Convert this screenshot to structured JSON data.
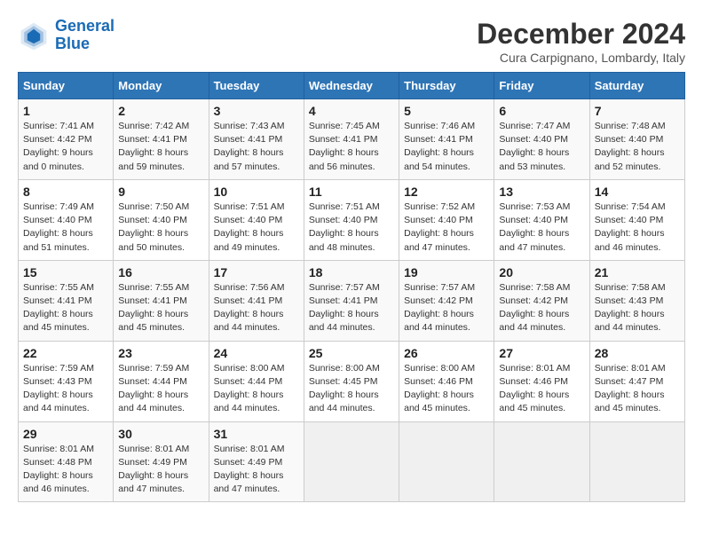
{
  "header": {
    "logo_line1": "General",
    "logo_line2": "Blue",
    "month_title": "December 2024",
    "subtitle": "Cura Carpignano, Lombardy, Italy"
  },
  "days_of_week": [
    "Sunday",
    "Monday",
    "Tuesday",
    "Wednesday",
    "Thursday",
    "Friday",
    "Saturday"
  ],
  "weeks": [
    [
      {
        "day": 1,
        "info": "Sunrise: 7:41 AM\nSunset: 4:42 PM\nDaylight: 9 hours\nand 0 minutes."
      },
      {
        "day": 2,
        "info": "Sunrise: 7:42 AM\nSunset: 4:41 PM\nDaylight: 8 hours\nand 59 minutes."
      },
      {
        "day": 3,
        "info": "Sunrise: 7:43 AM\nSunset: 4:41 PM\nDaylight: 8 hours\nand 57 minutes."
      },
      {
        "day": 4,
        "info": "Sunrise: 7:45 AM\nSunset: 4:41 PM\nDaylight: 8 hours\nand 56 minutes."
      },
      {
        "day": 5,
        "info": "Sunrise: 7:46 AM\nSunset: 4:41 PM\nDaylight: 8 hours\nand 54 minutes."
      },
      {
        "day": 6,
        "info": "Sunrise: 7:47 AM\nSunset: 4:40 PM\nDaylight: 8 hours\nand 53 minutes."
      },
      {
        "day": 7,
        "info": "Sunrise: 7:48 AM\nSunset: 4:40 PM\nDaylight: 8 hours\nand 52 minutes."
      }
    ],
    [
      {
        "day": 8,
        "info": "Sunrise: 7:49 AM\nSunset: 4:40 PM\nDaylight: 8 hours\nand 51 minutes."
      },
      {
        "day": 9,
        "info": "Sunrise: 7:50 AM\nSunset: 4:40 PM\nDaylight: 8 hours\nand 50 minutes."
      },
      {
        "day": 10,
        "info": "Sunrise: 7:51 AM\nSunset: 4:40 PM\nDaylight: 8 hours\nand 49 minutes."
      },
      {
        "day": 11,
        "info": "Sunrise: 7:51 AM\nSunset: 4:40 PM\nDaylight: 8 hours\nand 48 minutes."
      },
      {
        "day": 12,
        "info": "Sunrise: 7:52 AM\nSunset: 4:40 PM\nDaylight: 8 hours\nand 47 minutes."
      },
      {
        "day": 13,
        "info": "Sunrise: 7:53 AM\nSunset: 4:40 PM\nDaylight: 8 hours\nand 47 minutes."
      },
      {
        "day": 14,
        "info": "Sunrise: 7:54 AM\nSunset: 4:40 PM\nDaylight: 8 hours\nand 46 minutes."
      }
    ],
    [
      {
        "day": 15,
        "info": "Sunrise: 7:55 AM\nSunset: 4:41 PM\nDaylight: 8 hours\nand 45 minutes."
      },
      {
        "day": 16,
        "info": "Sunrise: 7:55 AM\nSunset: 4:41 PM\nDaylight: 8 hours\nand 45 minutes."
      },
      {
        "day": 17,
        "info": "Sunrise: 7:56 AM\nSunset: 4:41 PM\nDaylight: 8 hours\nand 44 minutes."
      },
      {
        "day": 18,
        "info": "Sunrise: 7:57 AM\nSunset: 4:41 PM\nDaylight: 8 hours\nand 44 minutes."
      },
      {
        "day": 19,
        "info": "Sunrise: 7:57 AM\nSunset: 4:42 PM\nDaylight: 8 hours\nand 44 minutes."
      },
      {
        "day": 20,
        "info": "Sunrise: 7:58 AM\nSunset: 4:42 PM\nDaylight: 8 hours\nand 44 minutes."
      },
      {
        "day": 21,
        "info": "Sunrise: 7:58 AM\nSunset: 4:43 PM\nDaylight: 8 hours\nand 44 minutes."
      }
    ],
    [
      {
        "day": 22,
        "info": "Sunrise: 7:59 AM\nSunset: 4:43 PM\nDaylight: 8 hours\nand 44 minutes."
      },
      {
        "day": 23,
        "info": "Sunrise: 7:59 AM\nSunset: 4:44 PM\nDaylight: 8 hours\nand 44 minutes."
      },
      {
        "day": 24,
        "info": "Sunrise: 8:00 AM\nSunset: 4:44 PM\nDaylight: 8 hours\nand 44 minutes."
      },
      {
        "day": 25,
        "info": "Sunrise: 8:00 AM\nSunset: 4:45 PM\nDaylight: 8 hours\nand 44 minutes."
      },
      {
        "day": 26,
        "info": "Sunrise: 8:00 AM\nSunset: 4:46 PM\nDaylight: 8 hours\nand 45 minutes."
      },
      {
        "day": 27,
        "info": "Sunrise: 8:01 AM\nSunset: 4:46 PM\nDaylight: 8 hours\nand 45 minutes."
      },
      {
        "day": 28,
        "info": "Sunrise: 8:01 AM\nSunset: 4:47 PM\nDaylight: 8 hours\nand 45 minutes."
      }
    ],
    [
      {
        "day": 29,
        "info": "Sunrise: 8:01 AM\nSunset: 4:48 PM\nDaylight: 8 hours\nand 46 minutes."
      },
      {
        "day": 30,
        "info": "Sunrise: 8:01 AM\nSunset: 4:49 PM\nDaylight: 8 hours\nand 47 minutes."
      },
      {
        "day": 31,
        "info": "Sunrise: 8:01 AM\nSunset: 4:49 PM\nDaylight: 8 hours\nand 47 minutes."
      },
      null,
      null,
      null,
      null
    ]
  ]
}
